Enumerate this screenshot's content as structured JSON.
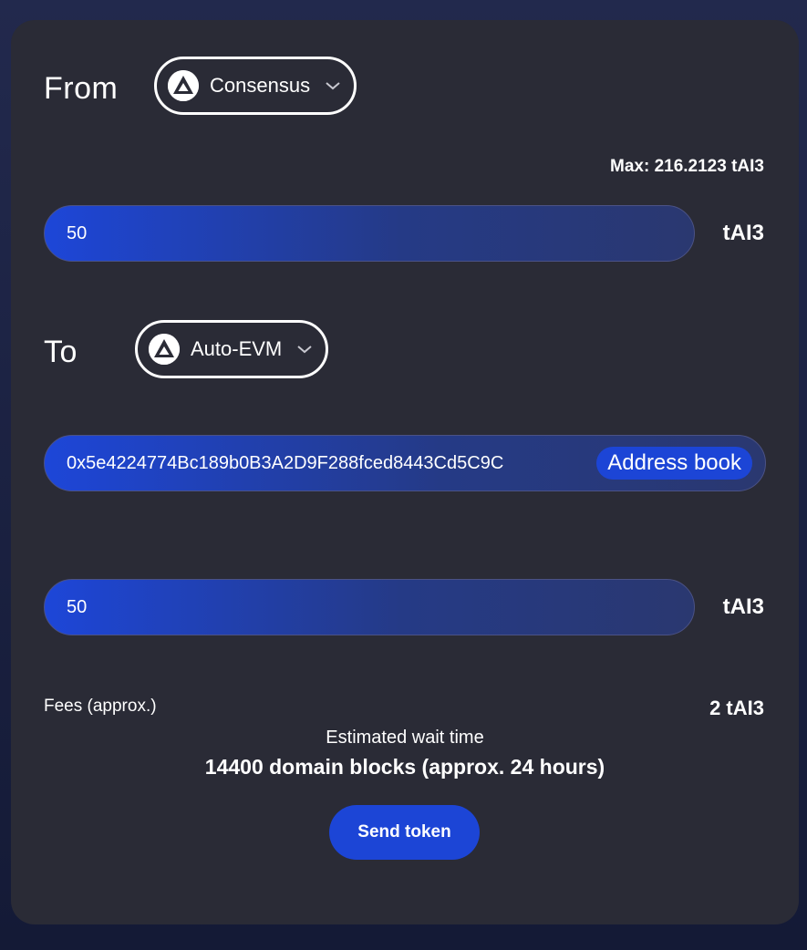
{
  "from": {
    "label": "From",
    "network": {
      "name": "Consensus",
      "icon": "autonomys-logo-icon"
    },
    "max_label": "Max: 216.2123 tAI3",
    "amount": "50",
    "unit": "tAI3"
  },
  "to": {
    "label": "To",
    "network": {
      "name": "Auto-EVM",
      "icon": "autonomys-logo-icon"
    },
    "address": "0x5e4224774Bc189b0B3A2D9F288fced8443Cd5C9C",
    "address_book_label": "Address book",
    "amount": "50",
    "unit": "tAI3"
  },
  "fees": {
    "label": "Fees (approx.)",
    "value": "2 tAI3"
  },
  "wait": {
    "label": "Estimated wait time",
    "value": "14400 domain blocks (approx. 24 hours)"
  },
  "send_button_label": "Send token",
  "colors": {
    "background": "#1a2044",
    "card": "#2a2b36",
    "accent": "#1c45d6"
  }
}
